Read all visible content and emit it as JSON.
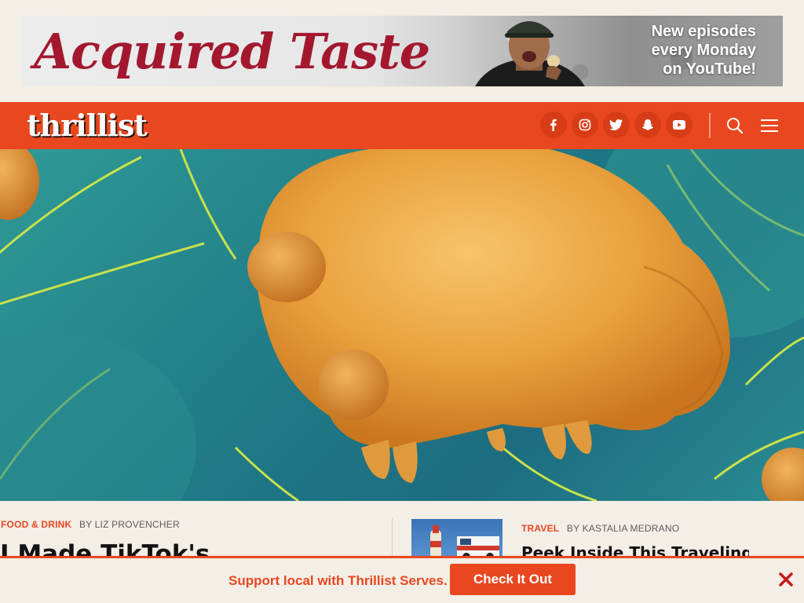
{
  "ad": {
    "logo_text": "Acquired Taste",
    "tagline": [
      "New episodes",
      "every Monday",
      "on YouTube!"
    ]
  },
  "header": {
    "brand": "thrillist",
    "social_icons": [
      "facebook-icon",
      "instagram-icon",
      "twitter-icon",
      "snapchat-icon",
      "youtube-icon"
    ],
    "search_icon": "search-icon",
    "menu_icon": "hamburger-menu-icon"
  },
  "articles": [
    {
      "category": "FOOD & DRINK",
      "byline": "BY LIZ PROVENCHER",
      "headline": "I Made TikTok's"
    },
    {
      "category": "TRAVEL",
      "byline": "BY KASTALIA MEDRANO",
      "headline": "Peek Inside This Traveling"
    }
  ],
  "sticky_bar": {
    "message": "Support local with Thrillist Serves.",
    "cta": "Check It Out",
    "close_icon": "close-icon"
  },
  "colors": {
    "brand_orange": "#e9471f",
    "ad_logo_red": "#a3182f",
    "page_bg": "#f3eee6",
    "hero_teal": "#1f7a86"
  }
}
